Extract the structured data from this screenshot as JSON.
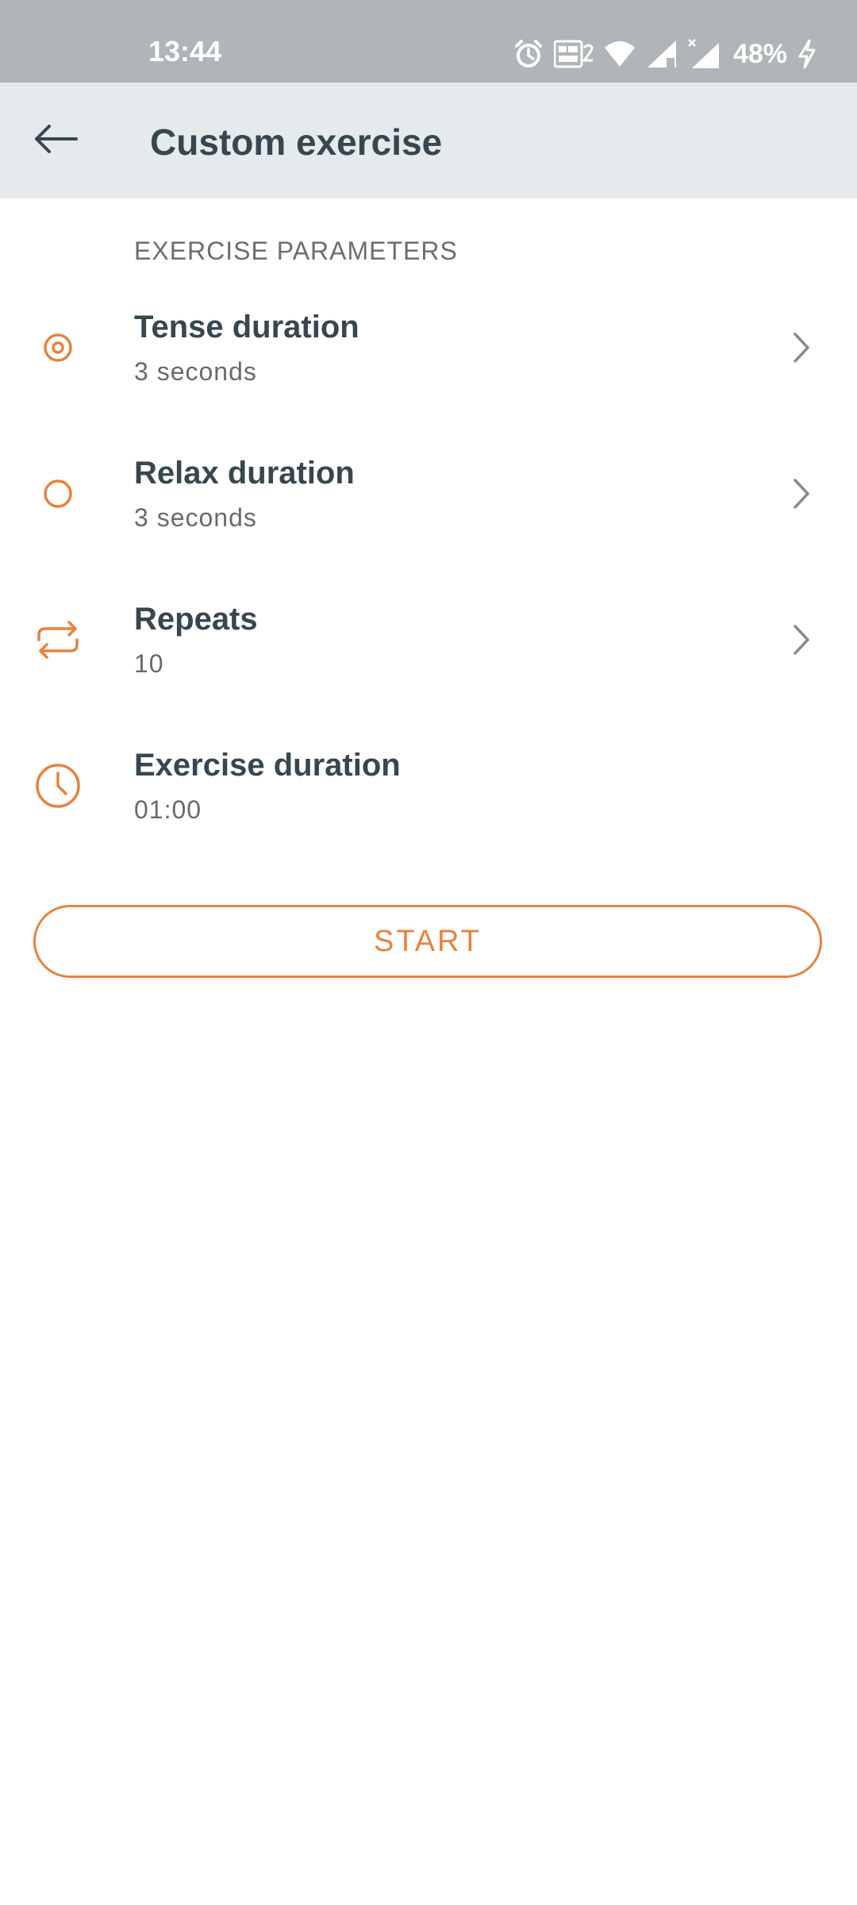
{
  "status_bar": {
    "time": "13:44",
    "battery": "48%",
    "icons": [
      "alarm-icon",
      "volte-icon",
      "wifi-icon",
      "signal-icon",
      "signal-icon",
      "charging-icon"
    ]
  },
  "app_bar": {
    "title": "Custom exercise",
    "back_icon": "arrow-left-icon"
  },
  "section": {
    "header": "EXERCISE PARAMETERS"
  },
  "params": [
    {
      "title": "Tense duration",
      "value": "3 seconds",
      "icon": "target-icon",
      "has_chevron": true
    },
    {
      "title": "Relax duration",
      "value": "3 seconds",
      "icon": "circle-icon",
      "has_chevron": true
    },
    {
      "title": "Repeats",
      "value": "10",
      "icon": "repeat-icon",
      "has_chevron": true
    },
    {
      "title": "Exercise duration",
      "value": "01:00",
      "icon": "clock-icon",
      "has_chevron": false
    }
  ],
  "start_button": {
    "label": "START"
  },
  "colors": {
    "accent": "#e8823b",
    "app_bar_bg": "#e5eaed",
    "status_bar_bg": "#b0b5b8",
    "text_primary": "#37474f",
    "text_secondary": "#6a6a6a"
  }
}
